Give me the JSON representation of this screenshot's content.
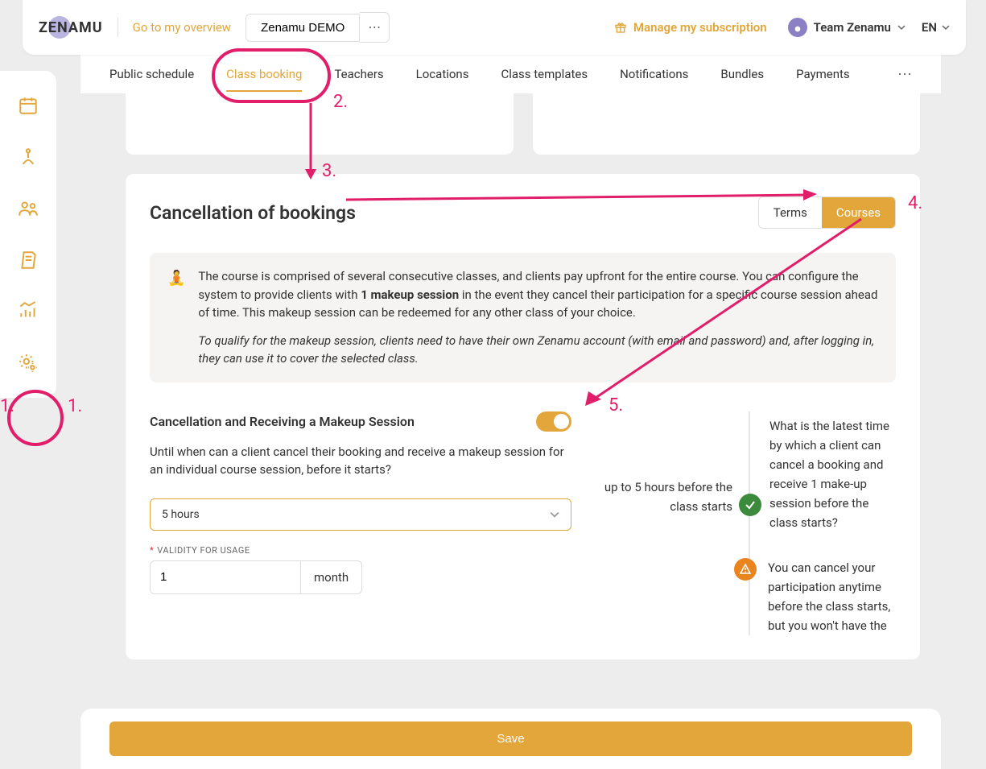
{
  "header": {
    "logo": "ZENAMU",
    "overview_link": "Go to my overview",
    "demo_button": "Zenamu DEMO",
    "subscription": "Manage my subscription",
    "team": "Team Zenamu",
    "lang": "EN"
  },
  "tabs": [
    "Public schedule",
    "Class booking",
    "Teachers",
    "Locations",
    "Class templates",
    "Notifications",
    "Bundles",
    "Payments"
  ],
  "active_tab_index": 1,
  "panel": {
    "title": "Cancellation of bookings",
    "toggle_terms": "Terms",
    "toggle_courses": "Courses",
    "info_text_1": "The course is comprised of several consecutive classes, and clients pay upfront for the entire course. You can configure the system to provide clients with ",
    "info_strong": "1 makeup session",
    "info_text_2": " in the event they cancel their participation for a specific course session ahead of time. This makeup session can be redeemed for any other class of your choice.",
    "info_italic": "To qualify for the makeup session, clients need to have their own Zenamu account (with email and password) and, after logging in, they can use it to cover the selected class.",
    "setting_title": "Cancellation and Receiving a Makeup Session",
    "setting_desc": "Until when can a client cancel their booking and receive a makeup session for an individual course session, before it starts?",
    "select_value": "5 hours",
    "validity_label": "VALIDITY FOR USAGE",
    "validity_value": "1",
    "validity_unit": "month",
    "mid_text": "up to 5 hours before the class starts",
    "right_q": "What is the latest time by which a client can cancel a booking and receive 1 make-up session before the class starts?",
    "warn_text": "You can cancel your participation anytime before the class starts, but you won't have the"
  },
  "save": "Save",
  "annotations": {
    "n1": "1.",
    "n2": "2.",
    "n3": "3.",
    "n4": "4.",
    "n5": "5."
  }
}
